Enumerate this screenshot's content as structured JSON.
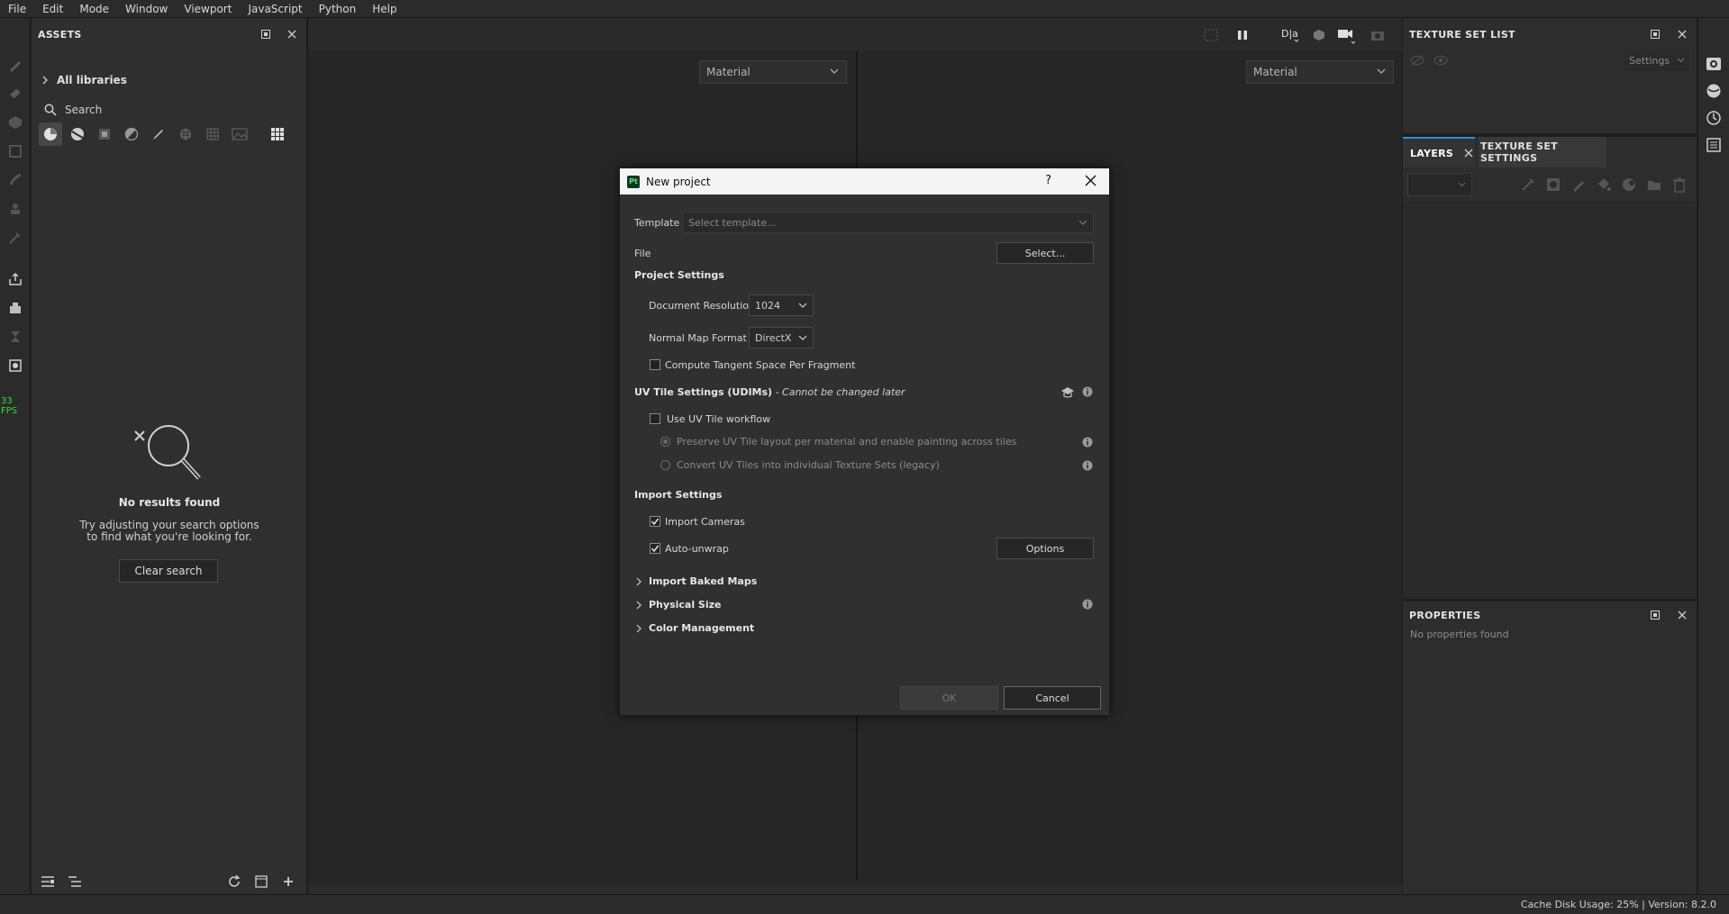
{
  "menu": [
    "File",
    "Edit",
    "Mode",
    "Window",
    "Viewport",
    "JavaScript",
    "Python",
    "Help"
  ],
  "fps": "33 FPS",
  "assets": {
    "title": "ASSETS",
    "library": "All libraries",
    "search_placeholder": "Search",
    "empty_title": "No results found",
    "empty_text": "Try adjusting your search options to find what you're looking for.",
    "clear_button": "Clear search"
  },
  "viewport": {
    "left_mode": "Material",
    "right_mode": "Material"
  },
  "texture_set_list": {
    "title": "TEXTURE SET LIST",
    "settings": "Settings"
  },
  "layers": {
    "tab_layers": "LAYERS",
    "tab_texture_settings": "TEXTURE SET SETTINGS"
  },
  "properties": {
    "title": "PROPERTIES",
    "empty": "No properties found"
  },
  "status": "Cache Disk Usage:   25% | Version: 8.2.0",
  "dialog": {
    "title": "New project",
    "help": "?",
    "logo": "Pt",
    "template_label": "Template",
    "template_placeholder": "Select template...",
    "file_label": "File",
    "file_button": "Select...",
    "project_settings": "Project Settings",
    "doc_res_label": "Document Resolution",
    "doc_res_value": "1024",
    "normal_label": "Normal Map Format",
    "normal_value": "DirectX",
    "tangent_label": "Compute Tangent Space Per Fragment",
    "uv_title": "UV Tile Settings (UDIMs)",
    "uv_note": " - Cannot be changed later",
    "uv_workflow": "Use UV Tile workflow",
    "uv_preserve": "Preserve UV Tile layout per material and enable painting across tiles",
    "uv_convert": "Convert UV Tiles into individual Texture Sets (legacy)",
    "import_settings": "Import Settings",
    "import_cameras": "Import Cameras",
    "auto_unwrap": "Auto-unwrap",
    "options_button": "Options",
    "baked_maps": "Import Baked Maps",
    "physical_size": "Physical Size",
    "color_mgmt": "Color Management",
    "ok": "OK",
    "cancel": "Cancel"
  }
}
